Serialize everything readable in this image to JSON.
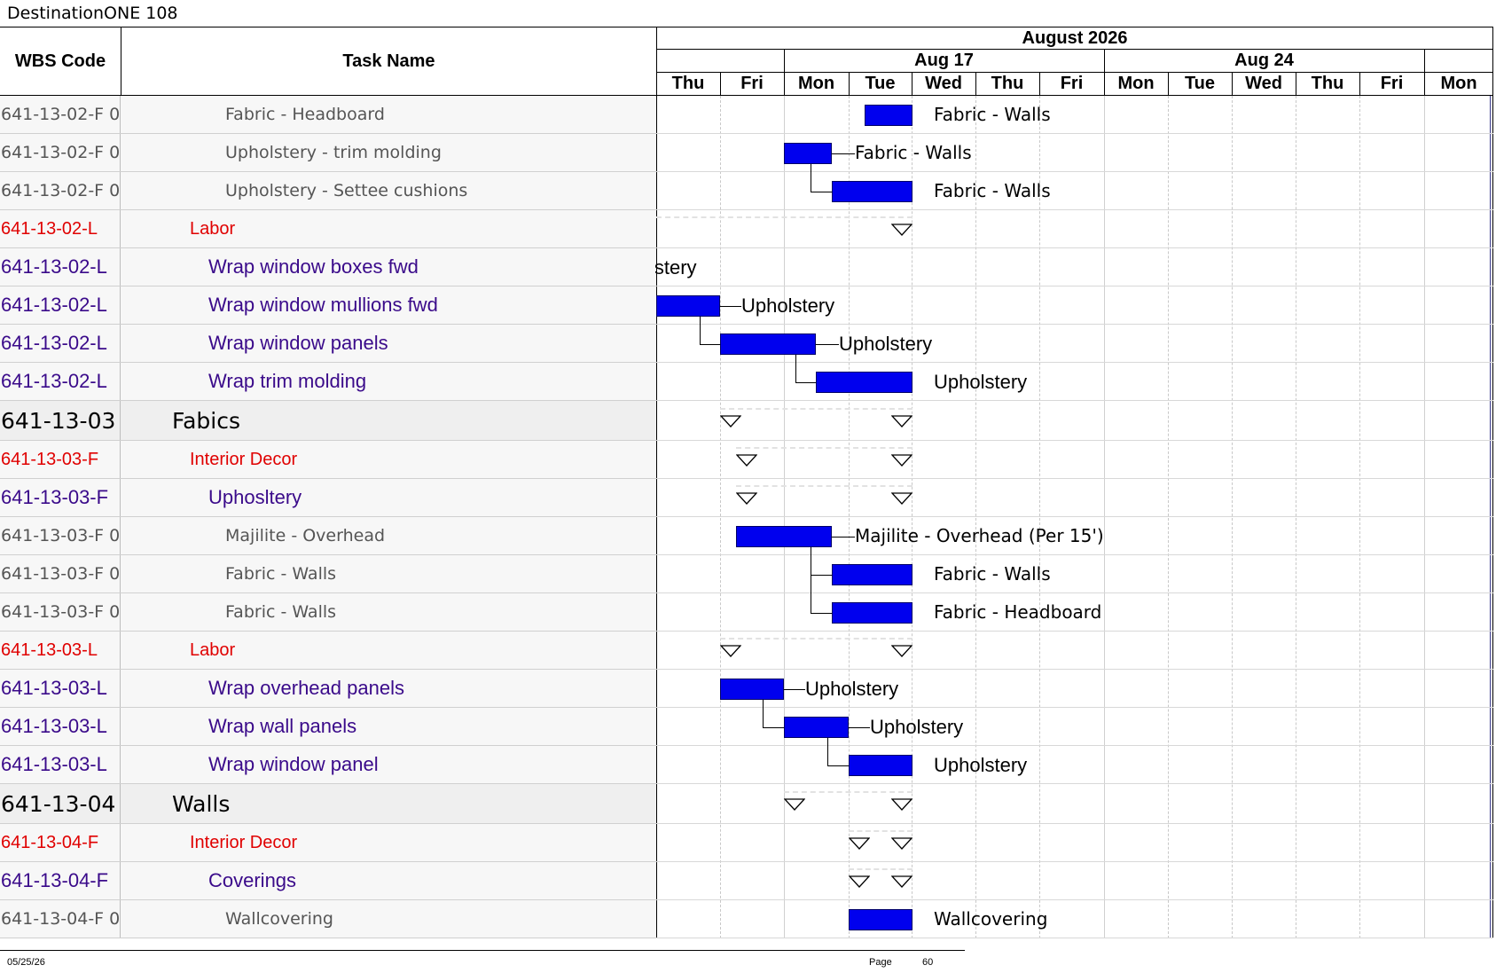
{
  "document": {
    "title": "DestinationONE 108"
  },
  "header": {
    "wbs_label": "WBS Code",
    "task_label": "Task Name",
    "month": "August 2026",
    "weeks": [
      "Aug 17",
      "Aug 24"
    ],
    "days": [
      "Thu",
      "Fri",
      "Mon",
      "Tue",
      "Wed",
      "Thu",
      "Fri",
      "Mon",
      "Tue",
      "Wed",
      "Thu",
      "Fri",
      "Mon"
    ]
  },
  "rows": [
    {
      "wbs": "641-13-02-F 0",
      "name": "Fabric - Headboard",
      "style": "task"
    },
    {
      "wbs": "641-13-02-F 0",
      "name": "Upholstery - trim molding",
      "style": "task"
    },
    {
      "wbs": "641-13-02-F 0",
      "name": "Upholstery - Settee cushions",
      "style": "task"
    },
    {
      "wbs": "641-13-02-L",
      "name": "Labor",
      "style": "cat"
    },
    {
      "wbs": "641-13-02-L",
      "name": "Wrap window boxes fwd",
      "style": "sub"
    },
    {
      "wbs": "641-13-02-L",
      "name": "Wrap window mullions fwd",
      "style": "sub"
    },
    {
      "wbs": "641-13-02-L",
      "name": "Wrap window panels",
      "style": "sub"
    },
    {
      "wbs": "641-13-02-L",
      "name": "Wrap trim molding",
      "style": "sub"
    },
    {
      "wbs": "641-13-03",
      "name": "Fabics",
      "style": "grp"
    },
    {
      "wbs": "641-13-03-F",
      "name": "Interior Decor",
      "style": "cat"
    },
    {
      "wbs": "641-13-03-F",
      "name": "Uphosltery",
      "style": "sub"
    },
    {
      "wbs": "641-13-03-F 0",
      "name": "Majilite - Overhead",
      "style": "task"
    },
    {
      "wbs": "641-13-03-F 0",
      "name": "Fabric - Walls",
      "style": "task"
    },
    {
      "wbs": "641-13-03-F 0",
      "name": "Fabric - Walls",
      "style": "task"
    },
    {
      "wbs": "641-13-03-L",
      "name": "Labor",
      "style": "cat"
    },
    {
      "wbs": "641-13-03-L",
      "name": "Wrap overhead panels",
      "style": "sub"
    },
    {
      "wbs": "641-13-03-L",
      "name": "Wrap wall panels",
      "style": "sub"
    },
    {
      "wbs": "641-13-03-L",
      "name": "Wrap window panel",
      "style": "sub"
    },
    {
      "wbs": "641-13-04",
      "name": "Walls",
      "style": "grp"
    },
    {
      "wbs": "641-13-04-F",
      "name": "Interior Decor",
      "style": "cat"
    },
    {
      "wbs": "641-13-04-F",
      "name": "Coverings",
      "style": "sub"
    },
    {
      "wbs": "641-13-04-F 0",
      "name": "Wallcovering",
      "style": "task"
    }
  ],
  "bar_labels": [
    "Fabric - Walls",
    "Fabric - Walls",
    "Fabric - Walls",
    "lstery",
    "Upholstery",
    "Upholstery",
    "Upholstery",
    "Majilite - Overhead (Per 15')",
    "Fabric - Walls",
    "Fabric - Headboard",
    "Upholstery",
    "Upholstery",
    "Upholstery",
    "Wallcovering"
  ],
  "footer": {
    "date": "05/25/26",
    "page_label": "Page",
    "page_number": "60"
  },
  "colors": {
    "bar": "#0000ee",
    "category": "#e00000",
    "subtask": "#3a0a8a",
    "task": "#555555"
  }
}
